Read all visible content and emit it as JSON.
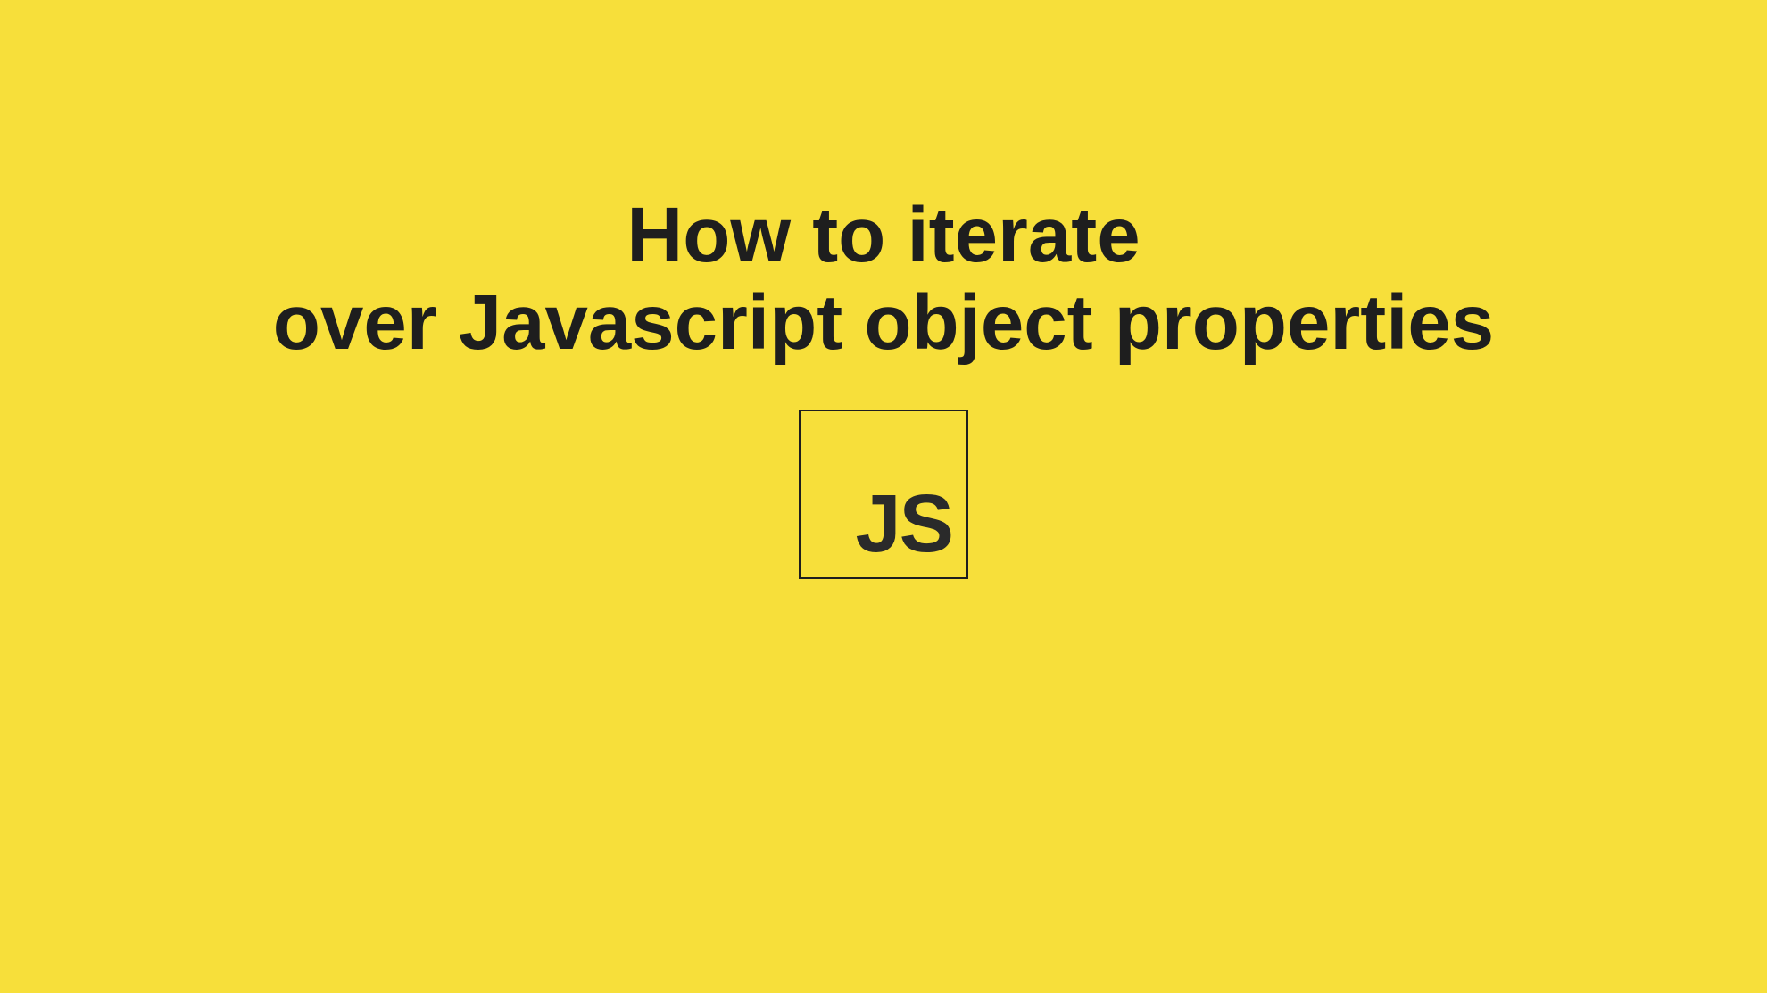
{
  "title": {
    "line1": "How to iterate",
    "line2": "over Javascript object properties"
  },
  "logo": {
    "text": "JS"
  },
  "colors": {
    "background": "#f7df3a",
    "text": "#1e1e1e"
  }
}
